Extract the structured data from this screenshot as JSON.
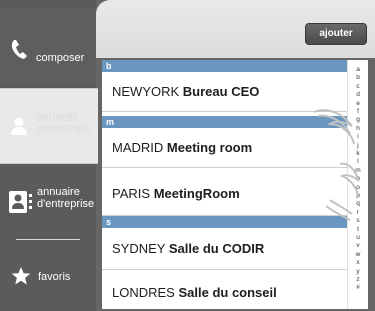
{
  "sidebar": {
    "items": [
      {
        "label": "composer",
        "icon": "phone-handset-icon"
      },
      {
        "label": "contacts\npersonnels",
        "icon": "person-icon"
      },
      {
        "label": "annuaire\nd'entreprise",
        "icon": "directory-icon"
      },
      {
        "label": "favoris",
        "icon": "star-icon"
      }
    ],
    "active_index": 1
  },
  "header": {
    "add_label": "ajouter"
  },
  "list": {
    "sections": [
      {
        "letter": "b",
        "rows": [
          {
            "city": "NEWYORK",
            "name": "Bureau CEO"
          }
        ]
      },
      {
        "letter": "m",
        "rows": [
          {
            "city": "MADRID",
            "name": "Meeting room"
          },
          {
            "city": "PARIS",
            "name": "MeetingRoom"
          }
        ]
      },
      {
        "letter": "s",
        "rows": [
          {
            "city": "SYDNEY",
            "name": "Salle du CODIR"
          },
          {
            "city": "LONDRES",
            "name": "Salle du conseil"
          }
        ]
      }
    ]
  },
  "alpha_index": [
    "a",
    "b",
    "c",
    "d",
    "e",
    "f",
    "g",
    "h",
    "i",
    "j",
    "k",
    "l",
    "m",
    "n",
    "o",
    "p",
    "q",
    "r",
    "s",
    "t",
    "u",
    "v",
    "w",
    "x",
    "y",
    "z",
    "#"
  ],
  "colors": {
    "section_header": "#6a97bf",
    "sidebar_bg": "#5b5b5b",
    "active_nav_bg": "#e9e9e9"
  }
}
